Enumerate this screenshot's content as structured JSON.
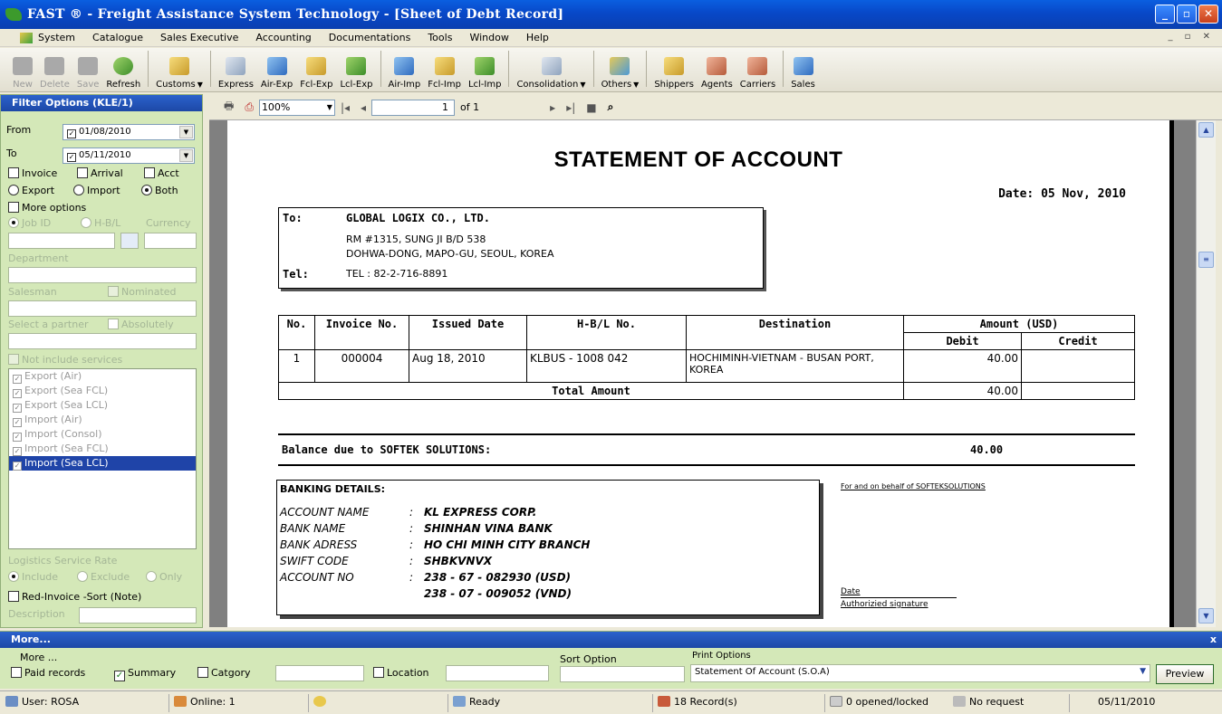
{
  "window": {
    "title": "FAST ® - Freight Assistance System Technology - [Sheet of Debt Record]"
  },
  "menu": [
    "System",
    "Catalogue",
    "Sales Executive",
    "Accounting",
    "Documentations",
    "Tools",
    "Window",
    "Help"
  ],
  "toolbar": {
    "new": "New",
    "delete": "Delete",
    "save": "Save",
    "refresh": "Refresh",
    "customs": "Customs",
    "express": "Express",
    "air_exp": "Air-Exp",
    "fcl_exp": "Fcl-Exp",
    "lcl_exp": "Lcl-Exp",
    "air_imp": "Air-Imp",
    "fcl_imp": "Fcl-Imp",
    "lcl_imp": "Lcl-Imp",
    "consolidation": "Consolidation",
    "others": "Others",
    "shippers": "Shippers",
    "agents": "Agents",
    "carriers": "Carriers",
    "sales": "Sales"
  },
  "filter": {
    "title": "Filter Options (KLE/1)",
    "from_label": "From",
    "from_value": "01/08/2010",
    "to_label": "To",
    "to_value": "05/11/2010",
    "invoice": "Invoice",
    "arrival": "Arrival",
    "acct": "Acct",
    "export": "Export",
    "import": "Import",
    "both": "Both",
    "more_options": "More options",
    "job_id": "Job ID",
    "hbl": "H-B/L",
    "currency": "Currency",
    "department": "Department",
    "salesman": "Salesman",
    "nominated": "Nominated",
    "select_partner": "Select a partner",
    "absolutely": "Absolutely",
    "not_include": "Not include services",
    "services": [
      "Export (Air)",
      "Export (Sea FCL)",
      "Export (Sea LCL)",
      "Import (Air)",
      "Import (Consol)",
      "Import (Sea FCL)",
      "Import (Sea LCL)"
    ],
    "logistics_rate": "Logistics Service Rate",
    "include": "Include",
    "exclude": "Exclude",
    "only": "Only",
    "red_invoice": "Red-Invoice -Sort (Note)",
    "description": "Description"
  },
  "report_toolbar": {
    "zoom": "100%",
    "page": "1",
    "of": "of 1"
  },
  "report": {
    "title": "STATEMENT OF ACCOUNT",
    "date": "Date: 05 Nov, 2010",
    "to_label": "To:",
    "to_name": "GLOBAL LOGIX CO., LTD.",
    "addr1": "RM #1315, SUNG JI B/D 538",
    "addr2": "DOHWA-DONG, MAPO-GU, SEOUL, KOREA",
    "tel_label": "Tel:",
    "tel_value": "TEL : 82-2-716-8891",
    "headers": {
      "no": "No.",
      "invoice": "Invoice No.",
      "issued": "Issued Date",
      "hbl": "H-B/L No.",
      "destination": "Destination",
      "amount": "Amount (USD)",
      "debit": "Debit",
      "credit": "Credit"
    },
    "row": {
      "no": "1",
      "invoice": "000004",
      "issued": "Aug 18, 2010",
      "hbl": "KLBUS - 1008 042",
      "destination": "HOCHIMINH-VIETNAM - BUSAN PORT, KOREA",
      "debit": "40.00",
      "credit": ""
    },
    "total_label": "Total Amount",
    "total_debit": "40.00",
    "balance_label": "Balance due to SOFTEK SOLUTIONS:",
    "balance_value": "40.00",
    "banking_title": "BANKING DETAILS:",
    "bank_rows": [
      {
        "k": "ACCOUNT NAME",
        "v": "KL EXPRESS CORP."
      },
      {
        "k": "BANK NAME",
        "v": "SHINHAN VINA BANK"
      },
      {
        "k": "BANK ADRESS",
        "v": "HO CHI MINH CITY BRANCH"
      },
      {
        "k": "SWIFT CODE",
        "v": "SHBKVNVX"
      },
      {
        "k": "ACCOUNT NO",
        "v": "238 - 67 - 082930 (USD)"
      }
    ],
    "bank_extra": "238 - 07 - 009052 (VND)",
    "behalf": "For and on behalf of SOFTEKSOLUTIONS",
    "date_label": "Date",
    "auth_sig": "Authorizied signature"
  },
  "more": {
    "title": "More...",
    "more_label": "More ...",
    "paid": "Paid records",
    "summary": "Summary",
    "category": "Catgory",
    "location": "Location",
    "sort_option": "Sort Option",
    "print_options": "Print Options",
    "print_value": "Statement Of Account (S.O.A)",
    "preview": "Preview",
    "close": "x"
  },
  "status": {
    "user": "User: ROSA",
    "online": "Online: 1",
    "ready": "Ready",
    "records": "18 Record(s)",
    "opened": "0 opened/locked",
    "request": "No request",
    "date": "05/11/2010"
  }
}
